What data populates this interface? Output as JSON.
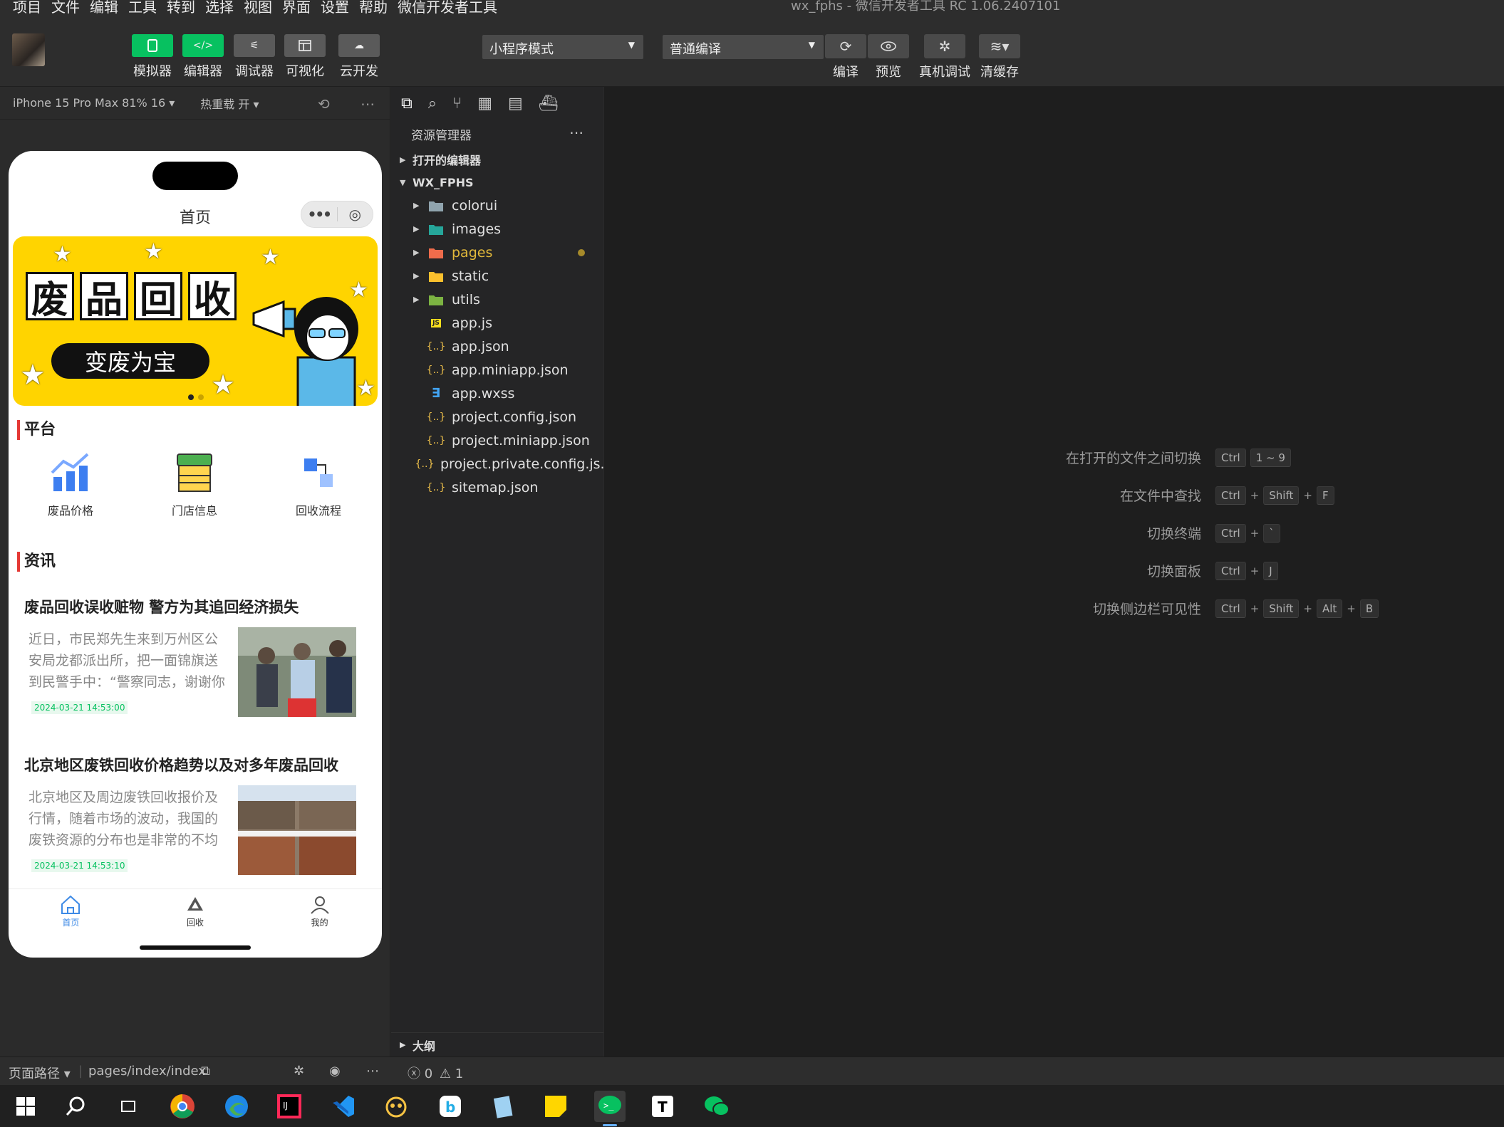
{
  "menubar": {
    "items": [
      "项目",
      "文件",
      "编辑",
      "工具",
      "转到",
      "选择",
      "视图",
      "界面",
      "设置",
      "帮助",
      "微信开发者工具"
    ],
    "window_title": "wx_fphs - 微信开发者工具 RC 1.06.2407101"
  },
  "toolbar": {
    "left_buttons": [
      {
        "label": "模拟器",
        "icon": "phone-icon"
      },
      {
        "label": "编辑器",
        "icon": "code-icon"
      },
      {
        "label": "调试器",
        "icon": "sliders-icon"
      },
      {
        "label": "可视化",
        "icon": "layout-icon"
      },
      {
        "label": "云开发",
        "icon": "cloud-icon"
      }
    ],
    "mode_select": "小程序模式",
    "compile_select": "普通编译",
    "right_buttons": [
      {
        "label": "编译",
        "icon": "refresh-icon"
      },
      {
        "label": "预览",
        "icon": "eye-icon"
      },
      {
        "label": "真机调试",
        "icon": "bug-icon"
      },
      {
        "label": "清缓存",
        "icon": "layers-icon"
      }
    ],
    "colors": {
      "green": "#07c160"
    }
  },
  "simulator": {
    "device": "iPhone 15 Pro Max 81% 16 ▾",
    "hot_reload": "热重载 开 ▾",
    "page": {
      "nav_title": "首页",
      "banner": {
        "chars": [
          "废",
          "品",
          "回",
          "收"
        ],
        "slogan": "变废为宝"
      },
      "platform_heading": "平台",
      "platform_items": [
        "废品价格",
        "门店信息",
        "回收流程"
      ],
      "news_heading": "资讯",
      "news": [
        {
          "title": "废品回收误收赃物 警方为其追回经济损失",
          "desc": "近日，市民郑先生来到万州区公安局龙都派出所，把一面锦旗送到民警手中：“警察同志，谢谢你",
          "time": "2024-03-21 14:53:00"
        },
        {
          "title": "北京地区废铁回收价格趋势以及对多年废品回收",
          "desc": "北京地区及周边废铁回收报价及行情，随着市场的波动，我国的废铁资源的分布也是非常的不均",
          "time": "2024-03-21 14:53:10"
        }
      ],
      "tabs": [
        "首页",
        "回收",
        "我的"
      ]
    }
  },
  "explorer": {
    "header": "资源管理器",
    "open_editors": "打开的编辑器",
    "project": "WX_FPHS",
    "folders": [
      {
        "name": "colorui",
        "color": "#90a4ae"
      },
      {
        "name": "images",
        "color": "#26a69a"
      },
      {
        "name": "pages",
        "color": "#ef6c4b"
      },
      {
        "name": "static",
        "color": "#fbc02d"
      },
      {
        "name": "utils",
        "color": "#7cb342"
      }
    ],
    "files": [
      {
        "name": "app.js",
        "icon": "JS"
      },
      {
        "name": "app.json",
        "icon": "{..}"
      },
      {
        "name": "app.miniapp.json",
        "icon": "{..}"
      },
      {
        "name": "app.wxss",
        "icon": "css"
      },
      {
        "name": "project.config.json",
        "icon": "{..}"
      },
      {
        "name": "project.miniapp.json",
        "icon": "{..}"
      },
      {
        "name": "project.private.config.js...",
        "icon": "{..}"
      },
      {
        "name": "sitemap.json",
        "icon": "{..}"
      }
    ],
    "outline": "大纲"
  },
  "shortcuts": [
    {
      "desc": "在打开的文件之间切换",
      "keys": [
        "Ctrl",
        "1 ~ 9"
      ],
      "joined": false
    },
    {
      "desc": "在文件中查找",
      "keys": [
        "Ctrl",
        "Shift",
        "F"
      ],
      "joined": true
    },
    {
      "desc": "切换终端",
      "keys": [
        "Ctrl",
        "`"
      ],
      "joined": true
    },
    {
      "desc": "切换面板",
      "keys": [
        "Ctrl",
        "J"
      ],
      "joined": true
    },
    {
      "desc": "切换侧边栏可见性",
      "keys": [
        "Ctrl",
        "Shift",
        "Alt",
        "B"
      ],
      "joined": true
    }
  ],
  "statusbar": {
    "page_path_label": "页面路径 ▾",
    "page_path": "pages/index/index",
    "errors": "0",
    "warnings": "1"
  }
}
